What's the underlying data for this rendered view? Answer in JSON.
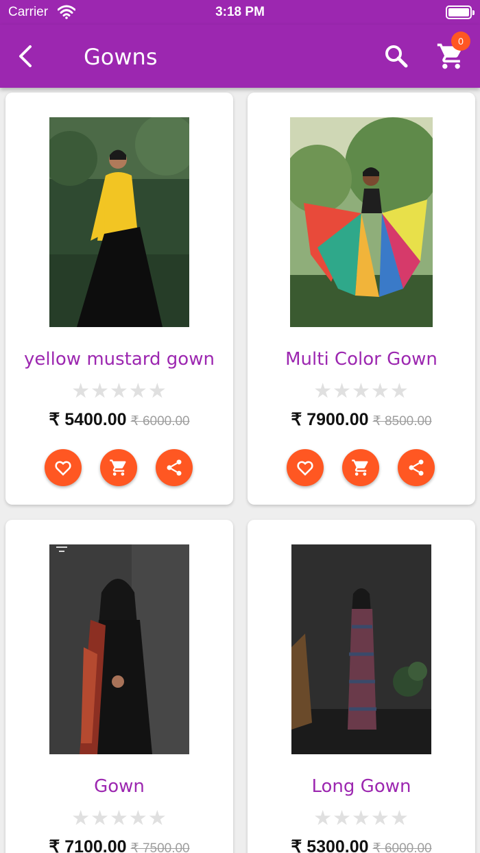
{
  "status_bar": {
    "carrier": "Carrier",
    "time": "3:18 PM"
  },
  "app_bar": {
    "title": "Gowns",
    "cart_count": "0"
  },
  "colors": {
    "primary": "#9c27b0",
    "accent": "#ff5722",
    "star_empty": "#e0e0e0"
  },
  "products": [
    {
      "name": "yellow mustard gown",
      "rating": 0,
      "stars": "★★★★★",
      "price": "₹ 5400.00",
      "old_price": "₹ 6000.00"
    },
    {
      "name": "Multi Color Gown",
      "rating": 0,
      "stars": "★★★★★",
      "price": "₹ 7900.00",
      "old_price": "₹ 8500.00"
    },
    {
      "name": "Gown",
      "rating": 0,
      "stars": "★★★★★",
      "price": "₹ 7100.00",
      "old_price": "₹ 7500.00"
    },
    {
      "name": "Long Gown",
      "rating": 0,
      "stars": "★★★★★",
      "price": "₹ 5300.00",
      "old_price": "₹ 6000.00"
    }
  ],
  "icons": [
    "back-arrow-icon",
    "search-icon",
    "cart-icon",
    "heart-icon",
    "add-to-cart-icon",
    "share-icon",
    "wifi-icon",
    "battery-icon"
  ]
}
